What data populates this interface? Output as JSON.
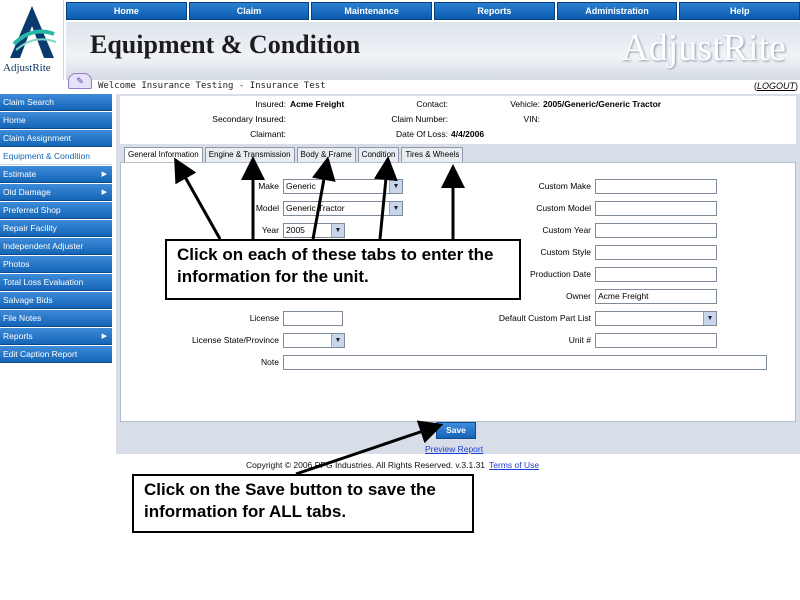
{
  "brand": {
    "logo_text": "AdjustRite",
    "wordmark": "AdjustRite"
  },
  "nav": [
    "Home",
    "Claim",
    "Maintenance",
    "Reports",
    "Administration",
    "Help"
  ],
  "header": {
    "title": "Equipment & Condition",
    "welcome": "Welcome Insurance Testing - Insurance Test",
    "logout": "LOGOUT"
  },
  "sidebar": [
    {
      "label": "Claim Search",
      "arrow": false
    },
    {
      "label": "Home",
      "arrow": false
    },
    {
      "label": "Claim Assignment",
      "arrow": false
    },
    {
      "label": "Equipment & Condition",
      "arrow": false,
      "active": true
    },
    {
      "label": "Estimate",
      "arrow": true
    },
    {
      "label": "Old Damage",
      "arrow": true
    },
    {
      "label": "Preferred Shop",
      "arrow": false
    },
    {
      "label": "Repair Facility",
      "arrow": false
    },
    {
      "label": "Independent Adjuster",
      "arrow": false
    },
    {
      "label": "Photos",
      "arrow": false
    },
    {
      "label": "Total Loss Evaluation",
      "arrow": false
    },
    {
      "label": "Salvage Bids",
      "arrow": false
    },
    {
      "label": "File Notes",
      "arrow": false
    },
    {
      "label": "Reports",
      "arrow": true
    },
    {
      "label": "Edit Caption Report",
      "arrow": false
    }
  ],
  "claim_info": {
    "insured_label": "Insured:",
    "insured_value": "Acme Freight",
    "contact_label": "Contact:",
    "vehicle_label": "Vehicle:",
    "vehicle_value": "2005/Generic/Generic Tractor",
    "secondary_label": "Secondary Insured:",
    "claim_number_label": "Claim Number:",
    "vin_label": "VIN:",
    "claimant_label": "Claimant:",
    "date_of_loss_label": "Date Of Loss:",
    "date_of_loss_value": "4/4/2006"
  },
  "tabs": [
    "General Information",
    "Engine & Transmission",
    "Body & Frame",
    "Condition",
    "Tires & Wheels"
  ],
  "form": {
    "make_label": "Make",
    "make_value": "Generic",
    "model_label": "Model",
    "model_value": "Generic Tractor",
    "year_label": "Year",
    "year_value": "2005",
    "license_label": "License",
    "license_state_label": "License State/Province",
    "note_label": "Note",
    "custom_make_label": "Custom Make",
    "custom_model_label": "Custom Model",
    "custom_year_label": "Custom Year",
    "custom_style_label": "Custom Style",
    "production_date_label": "Production Date",
    "owner_label": "Owner",
    "owner_value": "Acme Freight",
    "default_part_list_label": "Default Custom Part List",
    "unit_label": "Unit #"
  },
  "actions": {
    "save": "Save",
    "preview": "Preview Report"
  },
  "footer": {
    "copyright": "Copyright © 2006 PPG Industries. All Rights Reserved. v.3.1.31",
    "terms": "Terms of Use"
  },
  "callouts": {
    "tabs_hint": "Click on each of these tabs to enter the information for the unit.",
    "save_hint": "Click on the Save button to save the information for ALL tabs."
  }
}
